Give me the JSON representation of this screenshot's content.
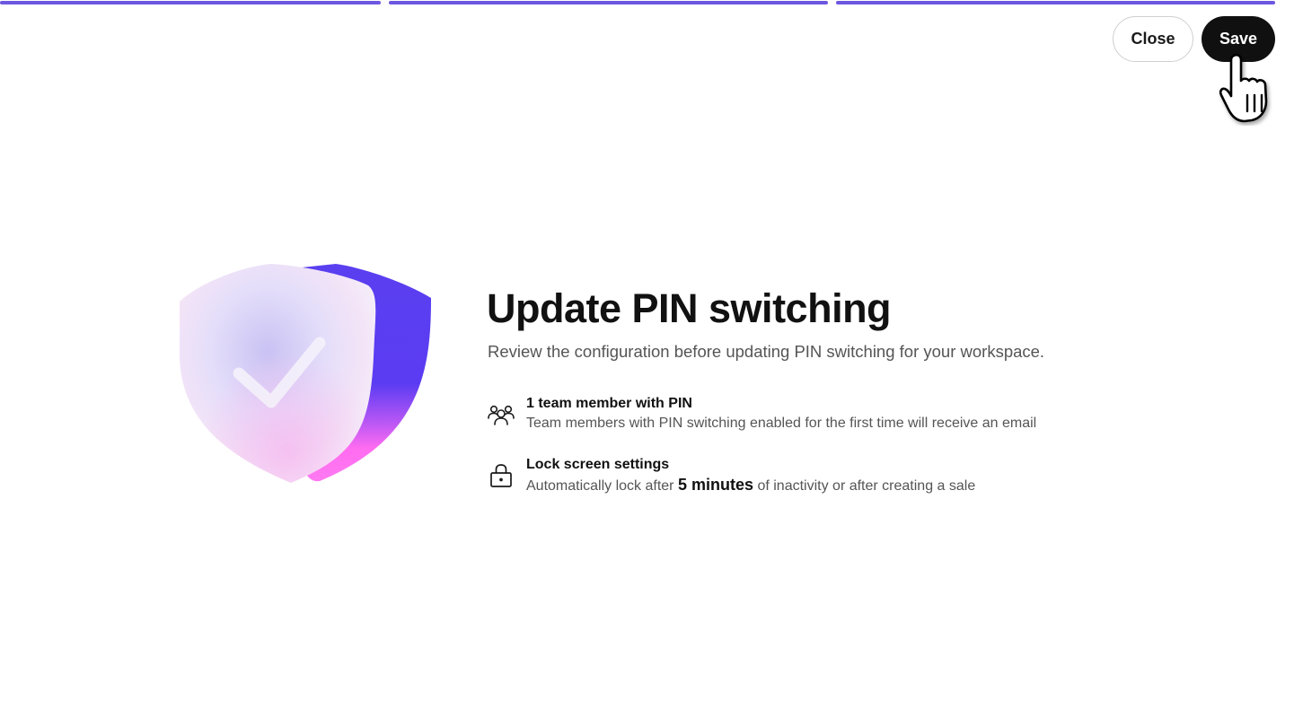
{
  "progress": {
    "steps_total": 3,
    "steps_complete": 3,
    "color": "#6b57e0"
  },
  "header": {
    "close_label": "Close",
    "save_label": "Save"
  },
  "illustration": {
    "icon": "shield-check-icon",
    "colors": {
      "back_shield_top": "#5a3ff0",
      "back_shield_bottom": "#ff6cf0"
    }
  },
  "main": {
    "title": "Update PIN switching",
    "subtitle": "Review the configuration before updating PIN switching for your workspace.",
    "items": [
      {
        "icon": "team-members-icon",
        "heading": "1 team member with PIN",
        "description": "Team members with PIN switching enabled for the first time will receive an email"
      },
      {
        "icon": "lock-icon",
        "heading": "Lock screen settings",
        "description_prefix": "Automatically lock after",
        "description_highlight": "5 minutes",
        "description_suffix": "of inactivity or after creating a sale"
      }
    ]
  },
  "cursor": {
    "icon": "hand-pointer-icon"
  }
}
